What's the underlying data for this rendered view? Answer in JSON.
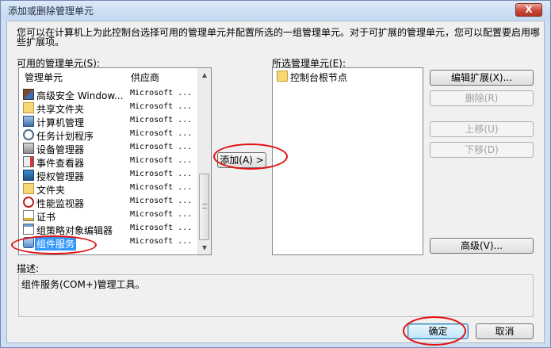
{
  "window": {
    "title": "添加或删除管理单元",
    "close_glyph": "X"
  },
  "intro_text": "您可以在计算机上为此控制台选择可用的管理单元并配置所选的一组管理单元。对于可扩展的管理单元，您可以配置要启用哪些扩展项。",
  "available": {
    "label": "可用的管理单元(S):",
    "columns": {
      "name": "管理单元",
      "vendor": "供应商"
    },
    "items": [
      {
        "name": "高级安全 Window...",
        "vendor": "Microsoft ...",
        "icon": "firewall-icon"
      },
      {
        "name": "共享文件夹",
        "vendor": "Microsoft ...",
        "icon": "shared-folder-icon"
      },
      {
        "name": "计算机管理",
        "vendor": "Microsoft ...",
        "icon": "computer-management-icon"
      },
      {
        "name": "任务计划程序",
        "vendor": "Microsoft ...",
        "icon": "clock-icon"
      },
      {
        "name": "设备管理器",
        "vendor": "Microsoft ...",
        "icon": "device-manager-icon"
      },
      {
        "name": "事件查看器",
        "vendor": "Microsoft ...",
        "icon": "event-viewer-icon"
      },
      {
        "name": "授权管理器",
        "vendor": "Microsoft ...",
        "icon": "authorization-icon"
      },
      {
        "name": "文件夹",
        "vendor": "Microsoft ...",
        "icon": "folder-icon"
      },
      {
        "name": "性能监视器",
        "vendor": "Microsoft ...",
        "icon": "performance-icon"
      },
      {
        "name": "证书",
        "vendor": "Microsoft ...",
        "icon": "certificate-icon"
      },
      {
        "name": "组策略对象编辑器",
        "vendor": "Microsoft ...",
        "icon": "group-policy-icon"
      },
      {
        "name": "组件服务",
        "vendor": "Microsoft ...",
        "icon": "component-services-icon",
        "selected": true
      }
    ]
  },
  "add_button": "添加(A) >",
  "selected": {
    "label": "所选管理单元(E):",
    "items": [
      {
        "name": "控制台根节点",
        "icon": "folder-icon"
      }
    ]
  },
  "side_buttons": {
    "edit_extensions": "编辑扩展(X)...",
    "remove": "删除(R)",
    "move_up": "上移(U)",
    "move_down": "下移(D)",
    "advanced": "高级(V)..."
  },
  "description": {
    "label": "描述:",
    "text": "组件服务(COM+)管理工具。"
  },
  "footer": {
    "ok": "确定",
    "cancel": "取消"
  },
  "colors": {
    "selection": "#3399ff",
    "annotation": "#e11010",
    "close_button": "#c9483a"
  }
}
